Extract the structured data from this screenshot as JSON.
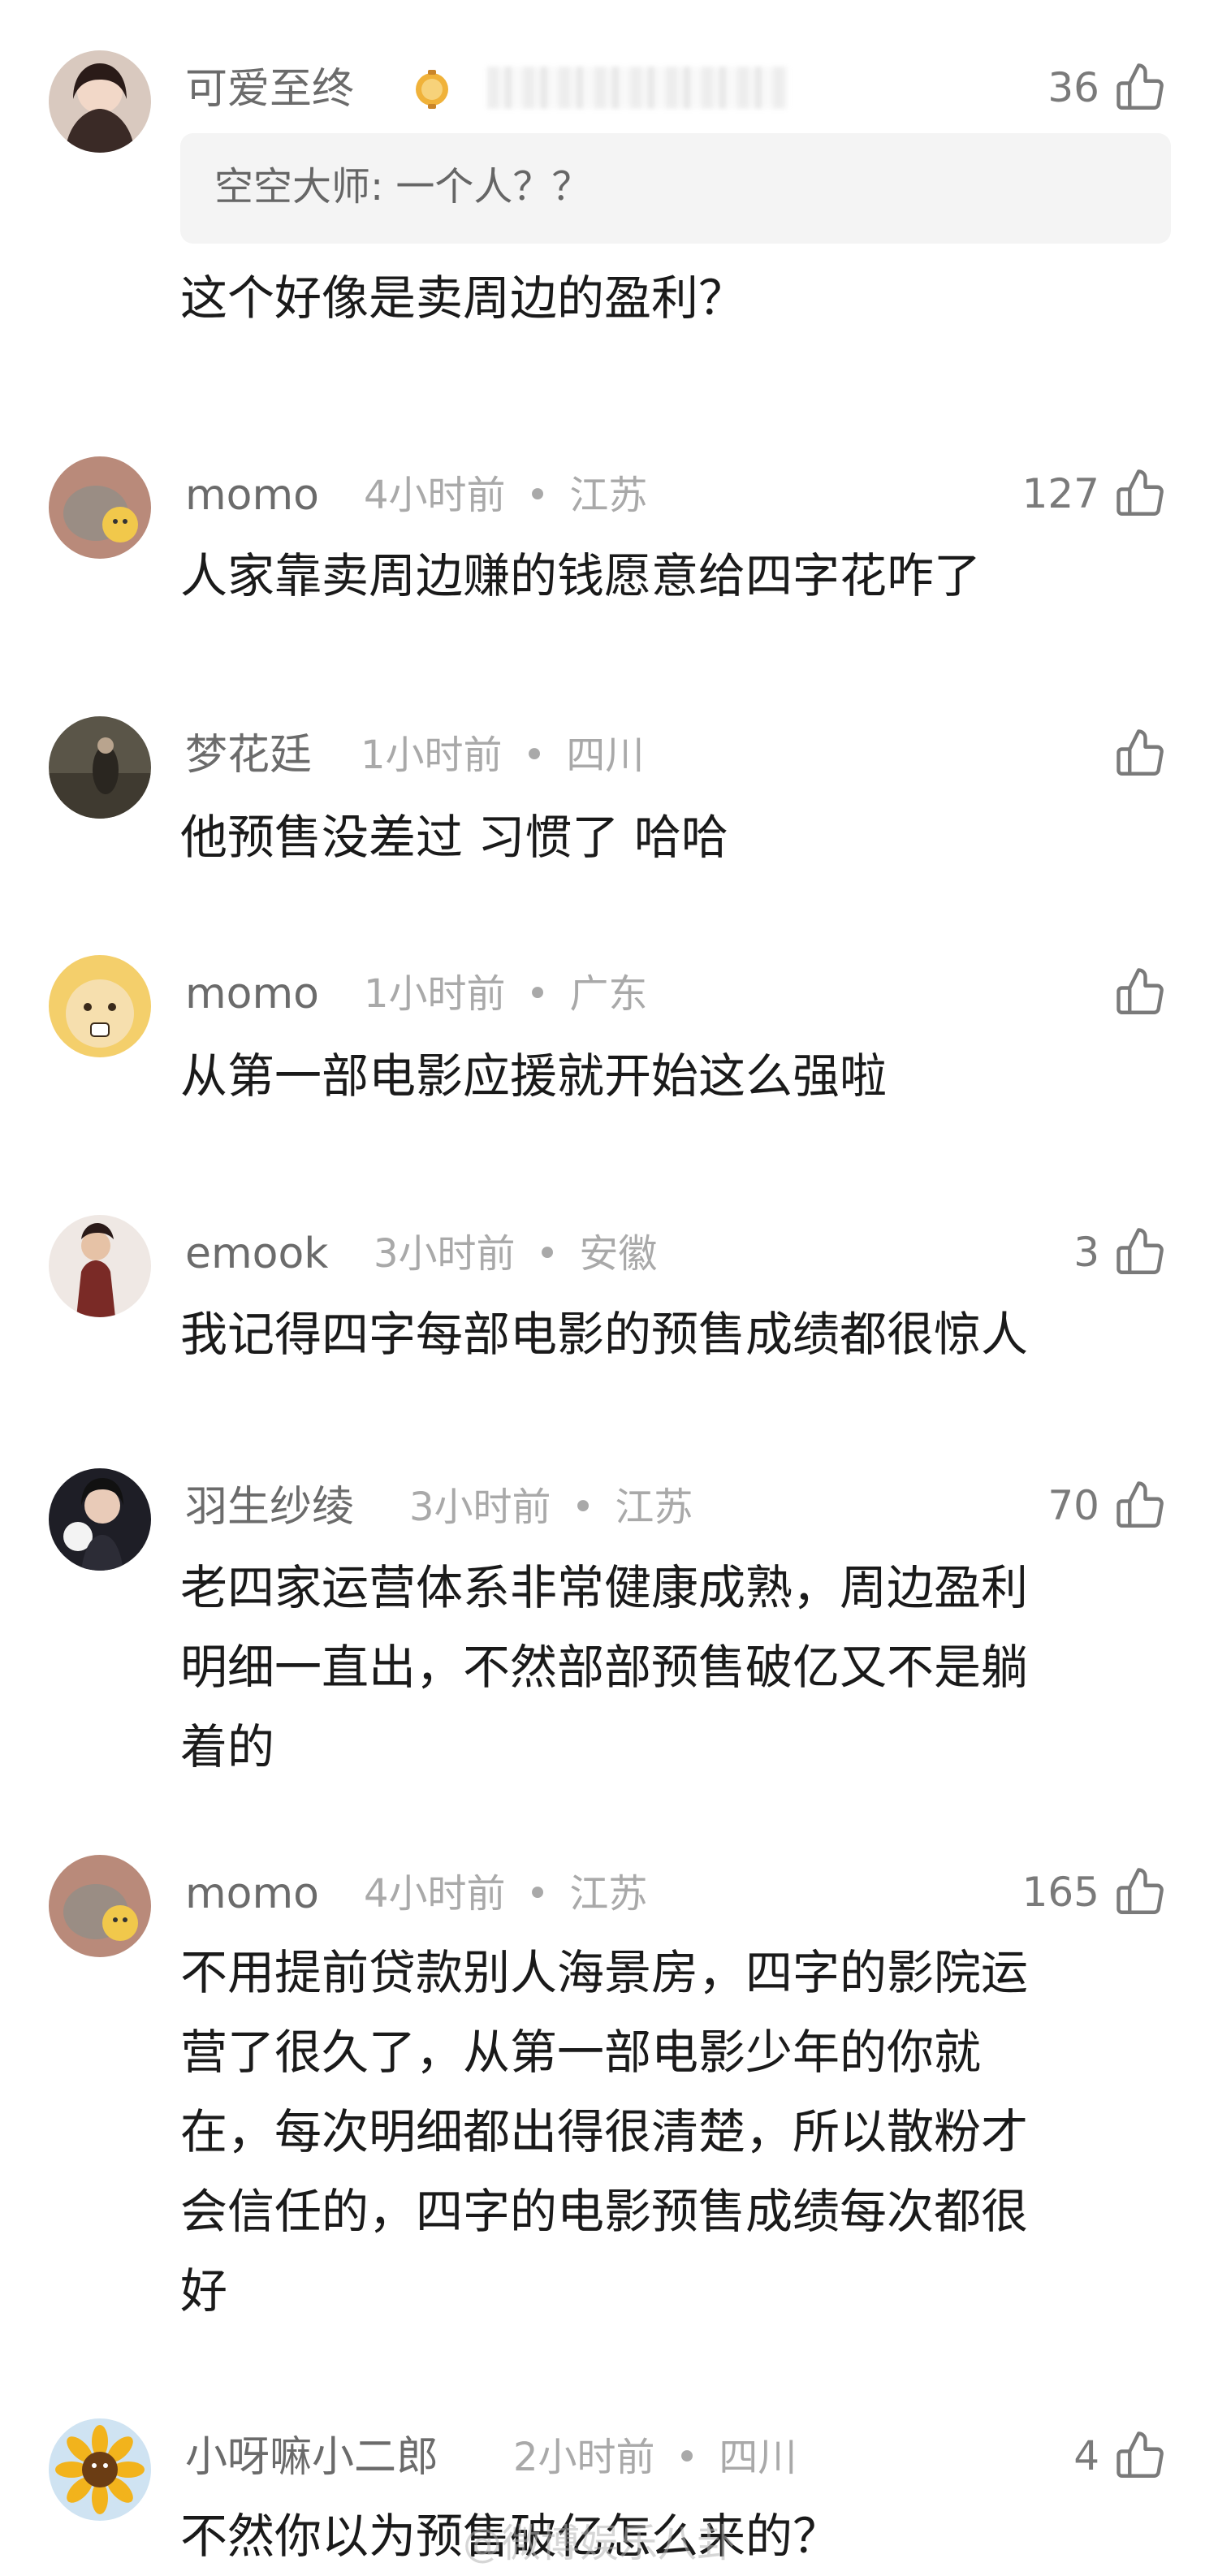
{
  "comments": [
    {
      "name": "可爱至终",
      "time": "",
      "location": "",
      "likes": "36",
      "quote": "空空大师: 一个人？？",
      "text": "这个好像是卖周边的盈利？"
    },
    {
      "name": "momo",
      "time": "4小时前",
      "location": "江苏",
      "likes": "127",
      "text": "人家靠卖周边赚的钱愿意给四字花咋了"
    },
    {
      "name": "梦花廷",
      "time": "1小时前",
      "location": "四川",
      "likes": "",
      "text": "他预售没差过 习惯了 哈哈"
    },
    {
      "name": "momo",
      "time": "1小时前",
      "location": "广东",
      "likes": "",
      "text": "从第一部电影应援就开始这么强啦"
    },
    {
      "name": "emook",
      "time": "3小时前",
      "location": "安徽",
      "likes": "3",
      "text": "我记得四字每部电影的预售成绩都很惊人"
    },
    {
      "name": "羽生纱绫",
      "time": "3小时前",
      "location": "江苏",
      "likes": "70",
      "lines": [
        "老四家运营体系非常健康成熟，周边盈利",
        "明细一直出，不然部部预售破亿又不是躺",
        "着的"
      ]
    },
    {
      "name": "momo",
      "time": "4小时前",
      "location": "江苏",
      "likes": "165",
      "lines": [
        "不用提前贷款别人海景房，四字的影院运",
        "营了很久了，从第一部电影少年的你就",
        "在，每次明细都出得很清楚，所以散粉才",
        "会信任的，四字的电影预售成绩每次都很",
        "好"
      ]
    },
    {
      "name": "小呀嘛小二郎",
      "time": "2小时前",
      "location": "四川",
      "likes": "4",
      "text": "不然你以为预售破亿怎么来的？"
    }
  ],
  "separator": "•",
  "watermark": "@微博娱乐八卦",
  "icons": {
    "like": "thumbs-up-icon",
    "badge": "lantern-badge-icon"
  },
  "colors": {
    "name": "#6b6b6b",
    "meta": "#a9a9a9",
    "text": "#1a1a1a",
    "quote_bg": "#f4f4f4"
  }
}
